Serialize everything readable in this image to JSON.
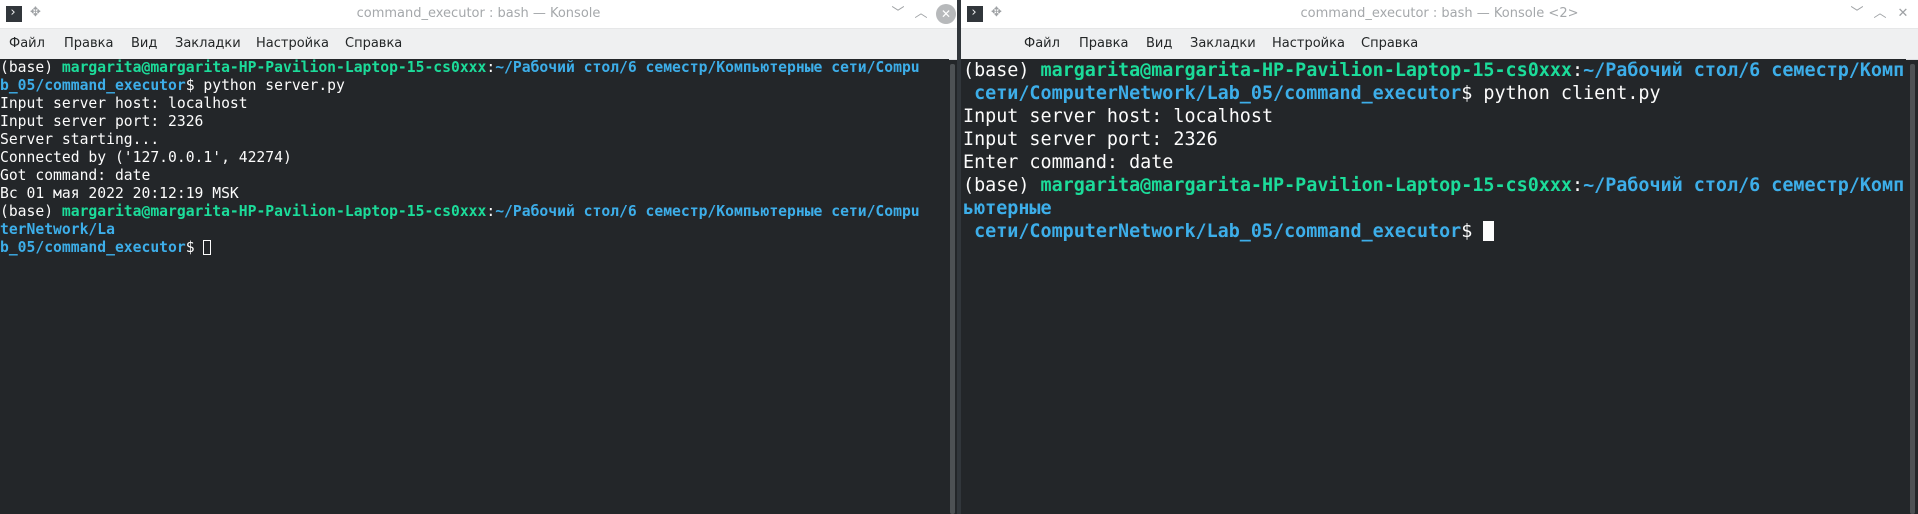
{
  "left_window": {
    "title": "command_executor : bash — Konsole",
    "menu": [
      "Файл",
      "Правка",
      "Вид",
      "Закладки",
      "Настройка",
      "Справка"
    ],
    "prompt1": {
      "prefix": "(base) ",
      "user": "margarita@margarita-HP-Pavilion-Laptop-15-cs0xxx",
      "sep": ":",
      "path_line1": "~/Рабочий стол/6 семестр/Компьютерные сети/Compu",
      "path_line2": "b_05/command_executor",
      "symbol": "$",
      "command": " python server.py"
    },
    "output": [
      "Input server host: localhost",
      "Input server port: 2326",
      "Server starting...",
      "Connected by ('127.0.0.1', 42274)",
      "Got command: date",
      "Вс 01 мая 2022 20:12:19 MSK"
    ],
    "prompt2": {
      "prefix": "(base) ",
      "user": "margarita@margarita-HP-Pavilion-Laptop-15-cs0xxx",
      "sep": ":",
      "path_line1": "~/Рабочий стол/6 семестр/Компьютерные сети/Compu",
      "path_line2": "terNetwork/La",
      "path_line3": "b_05/command_executor",
      "symbol": "$ "
    }
  },
  "right_window": {
    "title": "command_executor : bash — Konsole <2>",
    "menu": [
      "Файл",
      "Правка",
      "Вид",
      "Закладки",
      "Настройка",
      "Справка"
    ],
    "prompt1": {
      "prefix": "(base) ",
      "user": "margarita@margarita-HP-Pavilion-Laptop-15-cs0xxx",
      "sep": ":",
      "path_line1": "~/Рабочий стол/6 семестр/Комп",
      "path_line2": " сети/ComputerNetwork/Lab_05/command_executor",
      "symbol": "$",
      "command": " python client.py"
    },
    "output": [
      "Input server host: localhost",
      "Input server port: 2326",
      "Enter command: date"
    ],
    "prompt2": {
      "prefix": "(base) ",
      "user": "margarita@margarita-HP-Pavilion-Laptop-15-cs0xxx",
      "sep": ":",
      "path_line1": "~/Рабочий стол/6 семестр/Комп",
      "path_line2": "ьютерные",
      "path_line3": " сети/ComputerNetwork/Lab_05/command_executor",
      "symbol": "$ "
    }
  },
  "colors": {
    "terminal_bg": "#232629",
    "text": "#fcfcfc",
    "user_host": "#1cdc9a",
    "path": "#3daee9",
    "titlebar_bg": "#ffffff",
    "menubar_bg": "#eff0f1"
  }
}
